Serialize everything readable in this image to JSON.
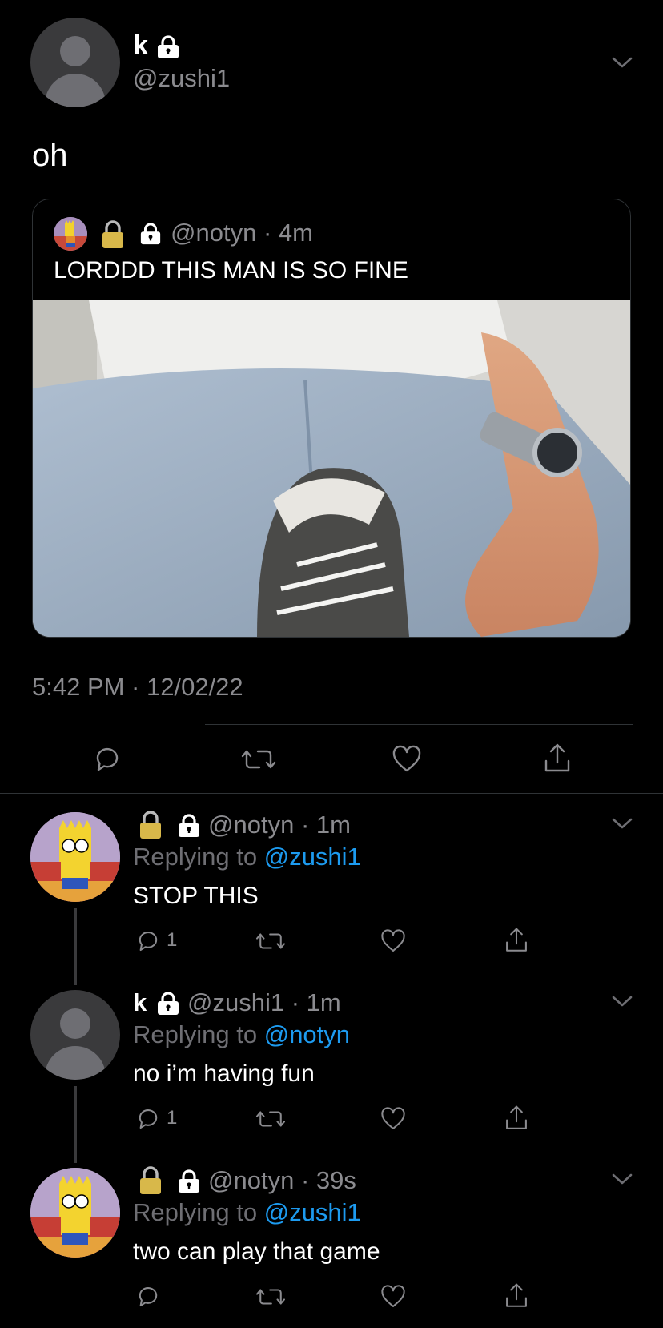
{
  "main_tweet": {
    "display_name": "k",
    "handle": "@zushi1",
    "text": "oh",
    "timestamp": "5:42 PM · 12/02/22"
  },
  "quoted_tweet": {
    "handle": "@notyn",
    "dot": "·",
    "time": "4m",
    "text": "LORDDD THIS MAN IS SO FINE"
  },
  "replies": [
    {
      "handle": "@notyn",
      "dot": "·",
      "time": "1m",
      "replying_prefix": "Replying to",
      "replying_to": "@zushi1",
      "text": "STOP THIS",
      "reply_count": "1"
    },
    {
      "display_name": "k",
      "handle": "@zushi1",
      "dot": "·",
      "time": "1m",
      "replying_prefix": "Replying to",
      "replying_to": "@notyn",
      "text": "no i’m having fun",
      "reply_count": "1"
    },
    {
      "handle": "@notyn",
      "dot": "·",
      "time": "39s",
      "replying_prefix": "Replying to",
      "replying_to": "@zushi1",
      "text": "two can play that game",
      "reply_count": ""
    }
  ],
  "colors": {
    "background": "#000000",
    "link": "#1d9bf0",
    "muted": "#8b8b8f"
  },
  "icons": [
    "lock-icon",
    "gold-padlock-icon",
    "chevron-down-icon",
    "reply-icon",
    "retweet-icon",
    "like-icon",
    "share-icon"
  ]
}
